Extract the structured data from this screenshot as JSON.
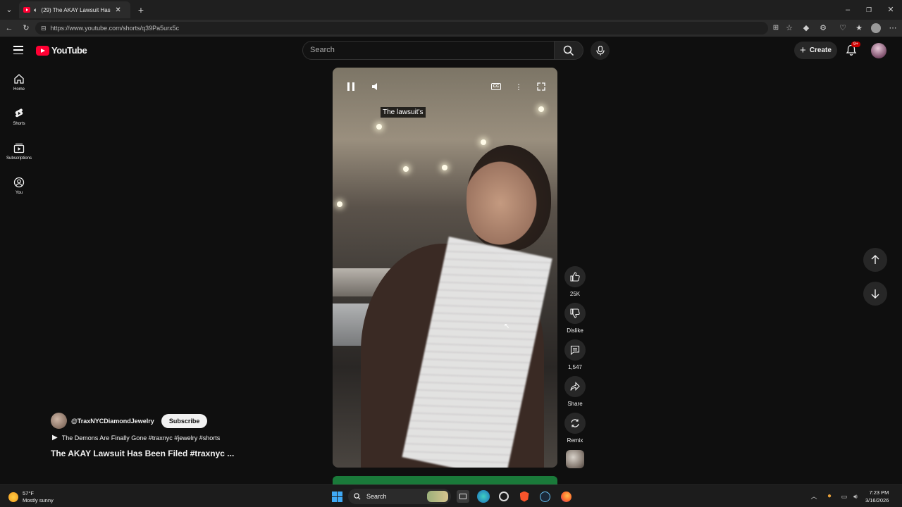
{
  "browser": {
    "tab_title": "(29) The AKAY Lawsuit Has Be",
    "url": "https://www.youtube.com/shorts/q39Pa5urx5c"
  },
  "header": {
    "logo_text": "YouTube",
    "search_placeholder": "Search",
    "create_label": "Create",
    "notifications_badge": "9+"
  },
  "sidebar": {
    "items": [
      {
        "label": "Home",
        "icon": "home-icon"
      },
      {
        "label": "Shorts",
        "icon": "shorts-icon"
      },
      {
        "label": "Subscriptions",
        "icon": "subscriptions-icon"
      },
      {
        "label": "You",
        "icon": "you-icon"
      }
    ]
  },
  "video": {
    "caption": "The lawsuit's"
  },
  "actions": {
    "like_count": "25K",
    "dislike_label": "Dislike",
    "comments_count": "1,547",
    "share_label": "Share",
    "remix_label": "Remix"
  },
  "channel": {
    "handle": "@TraxNYCDiamondJewelry",
    "subscribe_label": "Subscribe",
    "playlist": "The Demons Are Finally Gone #traxnyc #jewelry #shorts",
    "title": "The AKAY Lawsuit Has Been Filed #traxnyc ..."
  },
  "taskbar": {
    "weather_temp": "57°F",
    "weather_desc": "Mostly sunny",
    "search_label": "Search",
    "time": "7:23 PM",
    "date": "3/16/2026"
  },
  "colors": {
    "yt_red": "#ff0033",
    "background": "#0f0f0f",
    "accent_green": "#1a7a3a"
  }
}
